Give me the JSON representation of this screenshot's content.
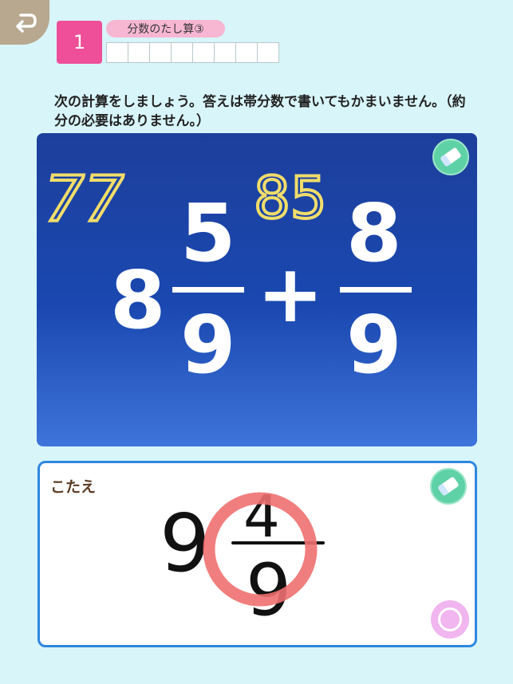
{
  "header": {
    "problem_number": "1",
    "title": "分数のたし算③",
    "progress_cells": 8
  },
  "instruction": "次の計算をしましょう。答えは帯分数で書いてもかまいません。（約分の必要はありません。）",
  "problem": {
    "whole": "8",
    "numerator1": "5",
    "denominator1": "9",
    "operator": "+",
    "numerator2": "8",
    "denominator2": "9",
    "handwritten_work": [
      "77",
      "85"
    ]
  },
  "answer": {
    "label": "こたえ",
    "handwritten_whole": "9",
    "handwritten_numerator": "4",
    "handwritten_denominator": "9"
  },
  "colors": {
    "background": "#d8f5f9",
    "badge": "#ef4f98",
    "board": "#1d3f9c",
    "answer_border": "#2f86e0",
    "handwriting_yellow": "#f1dd6a",
    "correct_circle": "#f07070"
  },
  "icons": {
    "back": "back-arrow-icon",
    "eraser": "eraser-icon",
    "check": "circle-check-icon"
  }
}
